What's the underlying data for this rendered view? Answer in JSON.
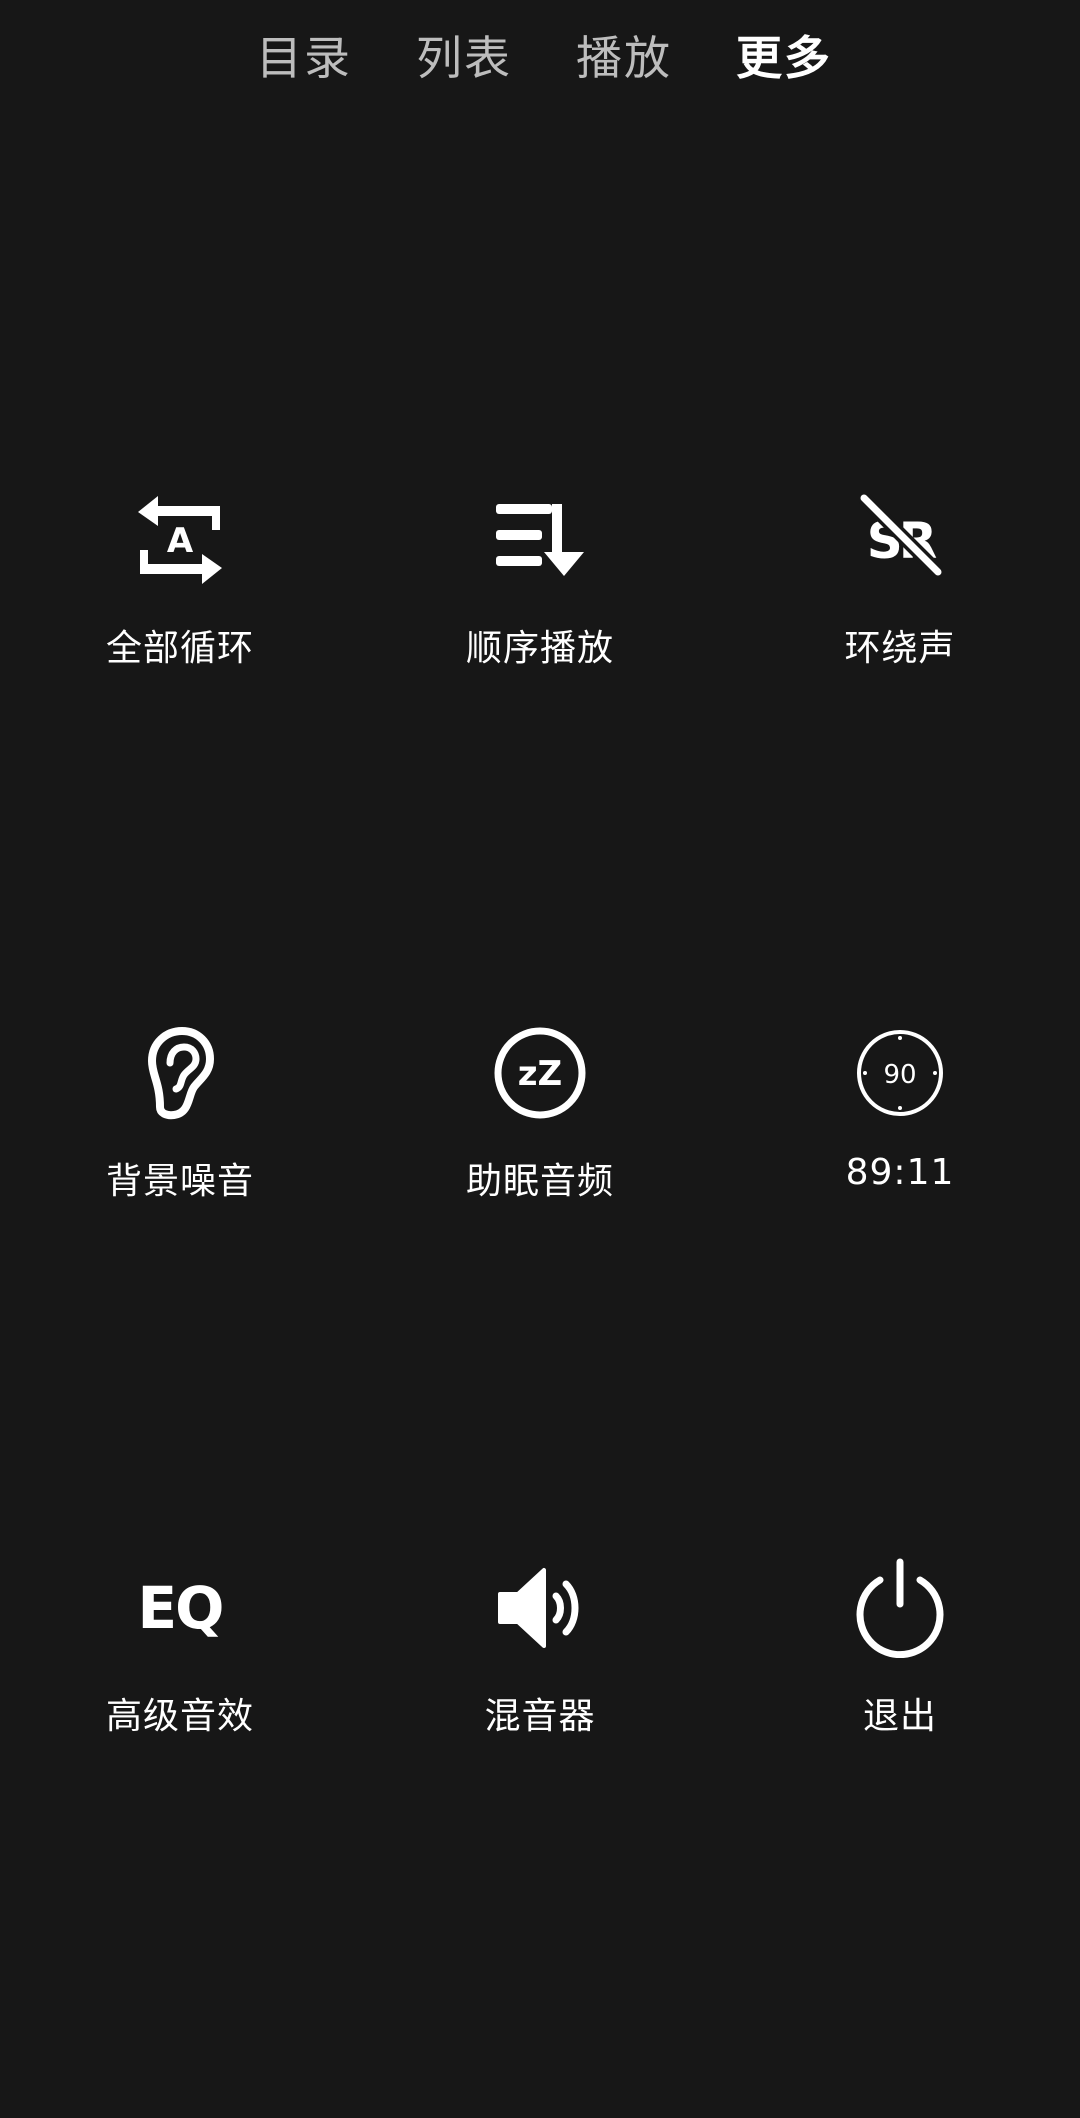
{
  "tabs": [
    {
      "label": "目录",
      "active": false
    },
    {
      "label": "列表",
      "active": false
    },
    {
      "label": "播放",
      "active": false
    },
    {
      "label": "更多",
      "active": true
    }
  ],
  "grid": [
    {
      "label": "全部循环",
      "icon": "repeat-all-icon",
      "icon_text": "A"
    },
    {
      "label": "顺序播放",
      "icon": "sequential-play-icon"
    },
    {
      "label": "环绕声",
      "icon": "surround-sound-off-icon",
      "icon_text": "SR"
    },
    {
      "label": "背景噪音",
      "icon": "ear-icon"
    },
    {
      "label": "助眠音频",
      "icon": "sleep-audio-icon",
      "icon_text": "zZ"
    },
    {
      "label": "89:11",
      "icon": "sleep-timer-icon",
      "icon_text": "90"
    },
    {
      "label": "高级音效",
      "icon": "eq-icon",
      "icon_text": "EQ"
    },
    {
      "label": "混音器",
      "icon": "speaker-icon"
    },
    {
      "label": "退出",
      "icon": "power-icon"
    }
  ],
  "colors": {
    "background": "#171717",
    "text": "#ffffff",
    "inactive_tab": "#bdbdbd"
  }
}
